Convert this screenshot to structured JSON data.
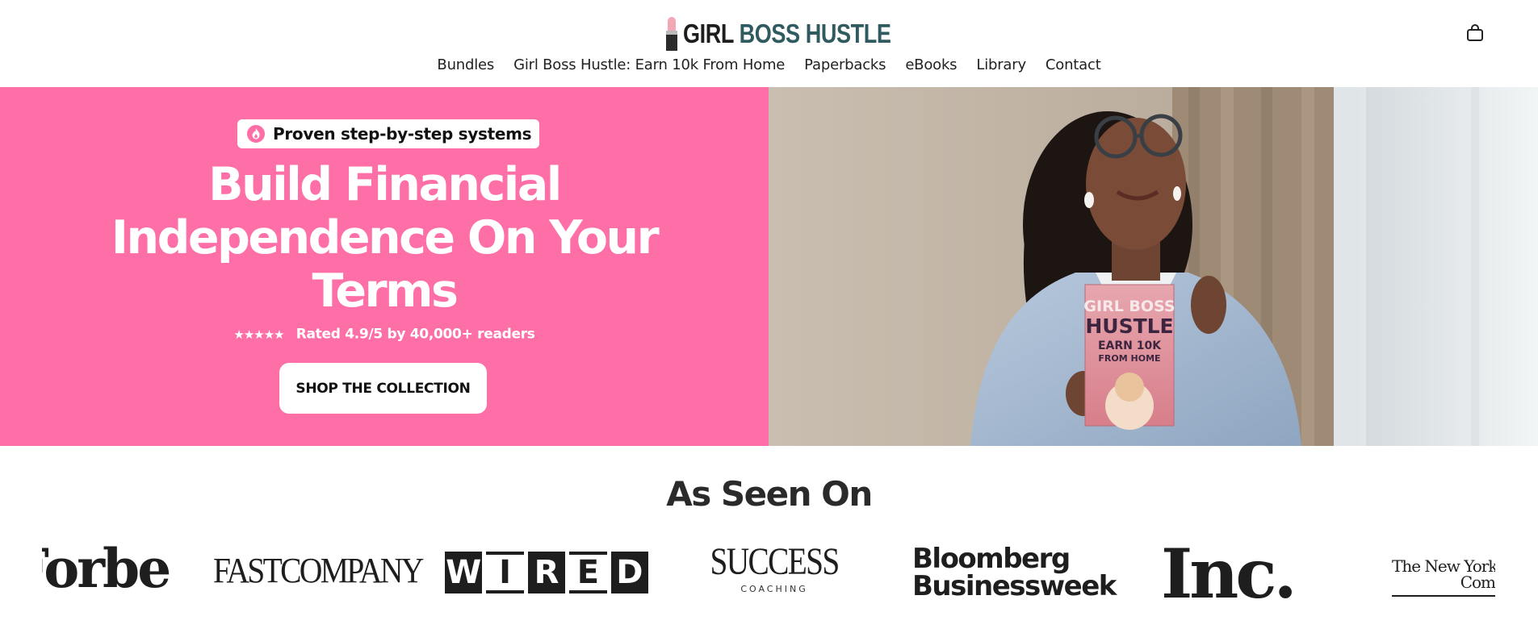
{
  "brand": {
    "logo_part1": "GIRL",
    "logo_part2": "BOSS HUSTLE",
    "accent_color": "#2f5a5f",
    "logo_icon": "lipstick-icon"
  },
  "header": {
    "cart_icon": "shopping-bag-icon"
  },
  "nav": {
    "items": [
      {
        "label": "Bundles"
      },
      {
        "label": "Girl Boss Hustle: Earn 10k From Home"
      },
      {
        "label": "Paperbacks"
      },
      {
        "label": "eBooks"
      },
      {
        "label": "Library"
      },
      {
        "label": "Contact"
      }
    ]
  },
  "hero": {
    "background_color": "#fe6ea7",
    "badge_icon": "flame-icon",
    "badge_text": "Proven step-by-step systems",
    "title": "Build Financial Independence On Your Terms",
    "stars": "★★★★★",
    "rating_text": "Rated 4.9/5 by 40,000+ readers",
    "cta_label": "SHOP THE COLLECTION",
    "book": {
      "line1": "GIRL BOSS",
      "line2": "HUSTLE",
      "line3": "EARN 10K",
      "line4": "FROM HOME"
    }
  },
  "seen_on": {
    "title": "As Seen On",
    "logos": {
      "forbes": "Forbes",
      "fastcompany": "FASTCOMPANY",
      "wired": [
        "W",
        "I",
        "R",
        "E",
        "D"
      ],
      "success_main": "SUCCESS",
      "success_sub": "COACHING",
      "bloomberg_line1": "Bloomberg",
      "bloomberg_line2": "Businessweek",
      "inc": "Inc.",
      "nyt_line1": "The New York T",
      "nyt_line2": "Com"
    }
  }
}
